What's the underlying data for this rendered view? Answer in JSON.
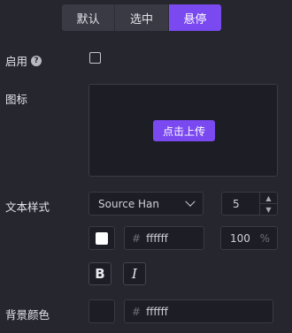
{
  "tabs": [
    {
      "label": "默认",
      "active": false
    },
    {
      "label": "选中",
      "active": false
    },
    {
      "label": "悬停",
      "active": true
    }
  ],
  "enable": {
    "label": "启用",
    "help_glyph": "?",
    "checked": false
  },
  "icon": {
    "label": "图标",
    "upload_label": "点击上传"
  },
  "text_style": {
    "label": "文本样式",
    "font_family": "Source Han",
    "font_size": "5",
    "color_hex": "ffffff",
    "hash": "#",
    "opacity": "100",
    "opacity_unit": "%",
    "bold_label": "B",
    "italic_label": "I",
    "color_swatch": "#ffffff"
  },
  "background": {
    "label": "背景颜色",
    "color_hex": "ffffff",
    "hash": "#",
    "color_swatch": "#1d1e25"
  },
  "colors": {
    "accent": "#7a49f0",
    "panel": "#25262e",
    "field": "#1d1e25"
  }
}
